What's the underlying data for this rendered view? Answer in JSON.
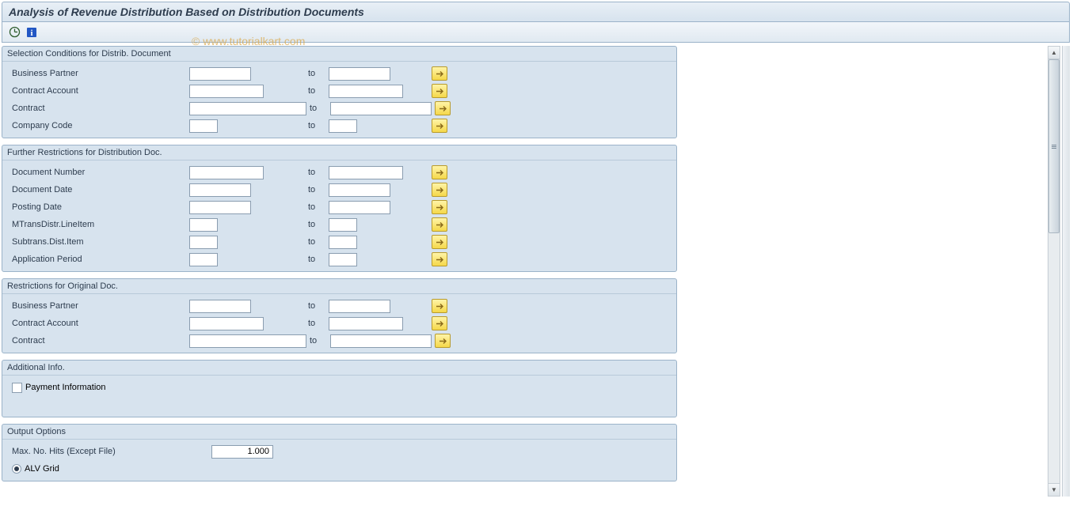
{
  "title": "Analysis of Revenue Distribution Based on Distribution Documents",
  "watermark": "© www.tutorialkart.com",
  "to_label": "to",
  "groups": {
    "g1": {
      "title": "Selection Conditions for Distrib. Document",
      "rows": {
        "business_partner": "Business Partner",
        "contract_account": "Contract Account",
        "contract": "Contract",
        "company_code": "Company Code"
      }
    },
    "g2": {
      "title": "Further Restrictions for Distribution Doc.",
      "rows": {
        "doc_number": "Document Number",
        "doc_date": "Document Date",
        "posting_date": "Posting Date",
        "mtrans": "MTransDistr.LineItem",
        "subtrans": "Subtrans.Dist.Item",
        "app_period": "Application Period"
      }
    },
    "g3": {
      "title": "Restrictions for Original Doc.",
      "rows": {
        "business_partner": "Business Partner",
        "contract_account": "Contract Account",
        "contract": "Contract"
      }
    },
    "g4": {
      "title": "Additional Info.",
      "payment_info": "Payment Information"
    },
    "g5": {
      "title": "Output Options",
      "max_hits_label": "Max. No. Hits (Except File)",
      "max_hits_value": "1.000",
      "alv_grid": "ALV Grid"
    }
  }
}
